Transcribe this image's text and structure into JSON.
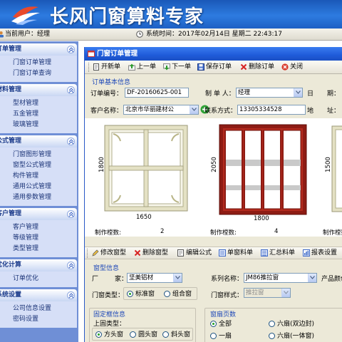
{
  "app": {
    "title": "长风门窗算料专家"
  },
  "status": {
    "user_label": "当前用户：",
    "user": "经理",
    "time_label": "系统时间：",
    "time": "2017年02月14日 星期二 22:43:17"
  },
  "sidebar": {
    "groups": [
      {
        "title": "订单管理",
        "items": [
          "门窗订单管理",
          "门窗订单查询"
        ]
      },
      {
        "title": "材料管理",
        "items": [
          "型材管理",
          "五金管理",
          "玻璃管理"
        ]
      },
      {
        "title": "公式管理",
        "items": [
          "门窗图形管理",
          "窗型公式管理",
          "构件管理",
          "通用公式管理",
          "通用参数管理"
        ]
      },
      {
        "title": "客户管理",
        "items": [
          "客户管理",
          "等级管理",
          "类型管理"
        ]
      },
      {
        "title": "优化计算",
        "items": [
          "订单优化"
        ]
      },
      {
        "title": "系统设置",
        "items": [
          "公司信息设置",
          "密码设置"
        ]
      }
    ]
  },
  "window": {
    "title": "门窗订单管理",
    "toolbar": [
      "开新单",
      "上一单",
      "下一单",
      "保存订单",
      "删除订单",
      "关闭"
    ]
  },
  "order": {
    "section": "订单基本信息",
    "number_label": "订单编号：",
    "number": "DF-20160625-001",
    "maker_label": "制 单 人：",
    "maker": "经理",
    "date_label": "日",
    "period_label": "期：",
    "customer_label": "客户名称：",
    "customer": "北京市华丽建材公",
    "contact_label": "联系方式：",
    "contact": "13305334528",
    "address_label": "地",
    "address_label2": "址："
  },
  "designs": [
    {
      "height": "1800",
      "width": "1650",
      "count_label": "制作樘数:",
      "count": "2"
    },
    {
      "height": "2050",
      "width": "1800",
      "count_label": "制作樘数:",
      "count": "4"
    },
    {
      "height": "1500",
      "count_label": "制作樘数:"
    }
  ],
  "window_toolbar": [
    "修改窗型",
    "删除窗型",
    "编辑公式",
    "单窗料单",
    "汇总料单",
    "报表设置"
  ],
  "window_type": {
    "section": "窗型信息",
    "factory_label1": "厂",
    "factory_label2": "家：",
    "factory": "坚美铝材",
    "series_label": "系列名称：",
    "series": "JM86推拉窗",
    "color_label": "产品颜色",
    "type_label": "门窗类型：",
    "type_options": [
      "标准窗",
      "组合窗"
    ],
    "style_label": "门窗样式：",
    "style": "推拉窗"
  },
  "fixed_frame": {
    "section": "固定框信息",
    "top_label": "上固类型：",
    "options": [
      "方头窗",
      "圆头窗",
      "斜头窗"
    ]
  },
  "sash_page": {
    "section": "窗扇页数",
    "options": [
      "全部",
      "六扇(双边封)",
      "一扇",
      "六扇(一体窗)"
    ]
  }
}
